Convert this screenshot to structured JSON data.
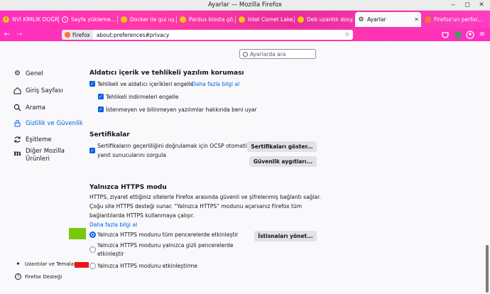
{
  "window": {
    "title": "Ayarlar — Mozilla Firefox"
  },
  "tabs": [
    {
      "label": "NVİ KİMLİK DOĞR...",
      "icon": "warning-icon"
    },
    {
      "label": "Sayfa yükleme...",
      "icon": "info-icon"
    },
    {
      "label": "Docker ile gui uy...",
      "icon": "pardus-icon"
    },
    {
      "label": "Pardus biosta gö...",
      "icon": "pardus-icon"
    },
    {
      "label": "Intel Comet Lake...",
      "icon": "pardus-icon"
    },
    {
      "label": "Deb uzantılı dosy...",
      "icon": "pardus-icon"
    },
    {
      "label": "Ayarlar",
      "icon": "gear-icon",
      "active": true
    },
    {
      "label": "Firefox'un perfor...",
      "icon": "firefox-icon"
    }
  ],
  "navbar": {
    "identity_label": "Firefox",
    "url": "about:preferences#privacy"
  },
  "search": {
    "placeholder": "Ayarlarda ara"
  },
  "sidebar": {
    "items": [
      {
        "label": "Genel",
        "icon": "gear-icon"
      },
      {
        "label": "Giriş Sayfası",
        "icon": "home-icon"
      },
      {
        "label": "Arama",
        "icon": "search-icon"
      },
      {
        "label": "Gizlilik ve Güvenlik",
        "icon": "lock-icon",
        "active": true
      },
      {
        "label": "Eşitleme",
        "icon": "sync-icon"
      },
      {
        "label": "Diğer Mozilla",
        "label2": "Ürünleri",
        "icon": "mozilla-icon"
      }
    ],
    "bottom": [
      {
        "label": "Uzantılar ve Temalar",
        "icon": "puzzle-icon"
      },
      {
        "label": "Firefox Desteği",
        "icon": "help-icon"
      }
    ]
  },
  "deceptive": {
    "heading": "Aldatıcı içerik ve tehlikeli yazılım koruması",
    "main_checkbox": "Tehlikeli ve aldatıcı içerikleri engelle",
    "learn_more": "Daha fazla bilgi al",
    "sub1": "Tehlikeli indirmeleri engelle",
    "sub2": "İstenmeyen ve bilinmeyen yazılımlar hakkında beni uyar"
  },
  "certificates": {
    "heading": "Sertifikalar",
    "ocsp_line1": "Sertifikaların geçerliliğini doğrulamak için OCSP otomatik",
    "ocsp_line2": "yanıt sunucularını sorgula",
    "view_button": "Sertifikaları göster...",
    "devices_button": "Güvenlik aygıtları..."
  },
  "https_only": {
    "heading": "Yalnızca HTTPS modu",
    "para_line1": "HTTPS, ziyaret ettiğiniz sitelerle Firefox arasında güvenli ve şifrelenmiş bağlantı sağlar.",
    "para_line2": "Çoğu site HTTPS desteği sunar. “Yalnızca HTTPS” modunu açarsanız Firefox tüm",
    "para_line3": "bağlantılarda HTTPS kullanmaya çalışır.",
    "learn_more": "Daha fazla bilgi al",
    "opt_all": "Yalnızca HTTPS modunu tüm pencerelerde etkinleştir",
    "opt_private_line1": "Yalnızca HTTPS modunu yalnızca gizli pencerelerde",
    "opt_private_line2": "etkinleştir",
    "opt_off": "Yalnızca HTTPS modunu etkinleştirme",
    "exceptions_button": "İstisnaları yönet...",
    "selected": "opt_all"
  },
  "colors": {
    "accent": "#0061e0",
    "tabbar": "#ff2dbf",
    "marker_green": "#7ac70c",
    "marker_red": "#e8151b"
  }
}
